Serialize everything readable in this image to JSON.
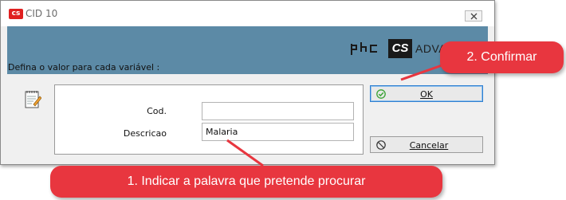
{
  "window": {
    "title": "CID 10",
    "app_icon_text": "cs"
  },
  "header": {
    "brand_cs": "CS",
    "brand_adv": "ADVAN",
    "prompt": "Defina o valor para cada variável :"
  },
  "form": {
    "cod_label": "Cod.",
    "cod_value": "",
    "descricao_label": "Descricao",
    "descricao_value": "Malaria"
  },
  "buttons": {
    "ok_label": "OK",
    "cancel_label": "Cancelar"
  },
  "callouts": {
    "step2": "2. Confirmar",
    "step1": "1. Indicar a palavra que pretende procurar"
  },
  "colors": {
    "header_band": "#5c8aa6",
    "callout": "#e8363f",
    "ok_check": "#3aa335"
  },
  "icons": [
    "close-icon",
    "notepad-icon",
    "checkmark-icon",
    "cancel-icon"
  ]
}
